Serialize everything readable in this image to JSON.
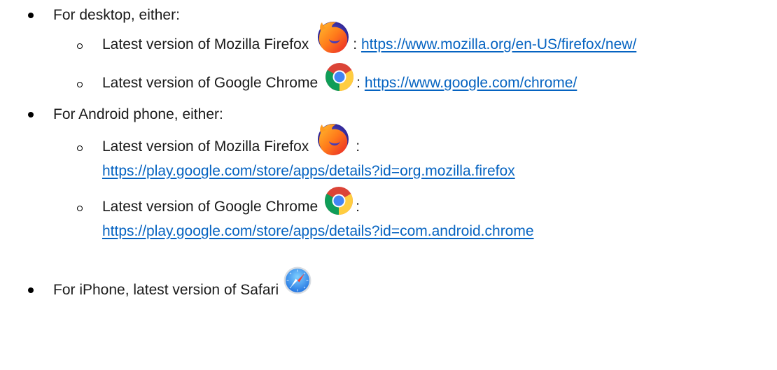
{
  "desktop": {
    "heading": "For desktop, either:",
    "firefox": {
      "text": "Latest version of Mozilla Firefox",
      "icon": "firefox-icon",
      "sep": ": ",
      "url": "https://www.mozilla.org/en-US/firefox/new/"
    },
    "chrome": {
      "text": "Latest version of Google Chrome",
      "icon": "chrome-icon",
      "sep": ": ",
      "url": "https://www.google.com/chrome/"
    }
  },
  "android": {
    "heading": "For Android phone, either:",
    "firefox": {
      "text": "Latest version of Mozilla Firefox",
      "icon": "firefox-icon",
      "sep": ":",
      "url": "https://play.google.com/store/apps/details?id=org.mozilla.firefox"
    },
    "chrome": {
      "text": "Latest version of Google Chrome",
      "icon": "chrome-icon",
      "sep": ":",
      "url": "https://play.google.com/store/apps/details?id=com.android.chrome"
    }
  },
  "iphone": {
    "text": "For iPhone, latest version of Safari",
    "icon": "safari-icon"
  },
  "colors": {
    "link": "#0563c1",
    "text": "#1a1a1a"
  }
}
